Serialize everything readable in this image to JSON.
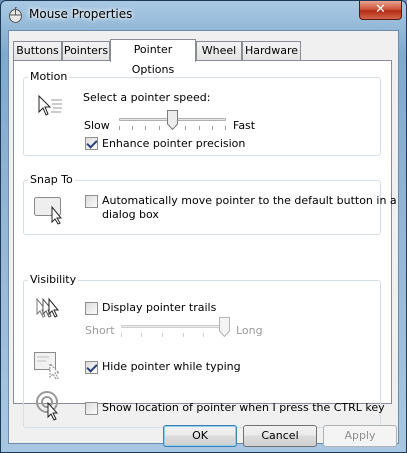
{
  "window": {
    "title": "Mouse Properties",
    "close_glyph": "✕"
  },
  "tabs": [
    {
      "label": "Buttons"
    },
    {
      "label": "Pointers"
    },
    {
      "label": "Pointer Options",
      "active": true
    },
    {
      "label": "Wheel"
    },
    {
      "label": "Hardware"
    }
  ],
  "motion": {
    "title": "Motion",
    "speed_label": "Select a pointer speed:",
    "slow": "Slow",
    "fast": "Fast",
    "speed_level": 0.5,
    "precision_label": "Enhance pointer precision",
    "precision_checked": true
  },
  "snap": {
    "title": "Snap To",
    "line1": "Automatically move pointer to the default button in a",
    "line2": "dialog box",
    "checked": false
  },
  "visibility": {
    "title": "Visibility",
    "trails_label": "Display pointer trails",
    "trails_checked": false,
    "short": "Short",
    "long": "Long",
    "trail_level": 1.0,
    "hide_label": "Hide pointer while typing",
    "hide_checked": true,
    "ctrl_label": "Show location of pointer when I press the CTRL key",
    "ctrl_checked": false
  },
  "buttons": {
    "ok": "OK",
    "cancel": "Cancel",
    "apply": "Apply"
  },
  "colors": {
    "titlebar": "#8fb3d3",
    "close": "#c7452b",
    "panel": "#ffffff",
    "default_border": "#3c7fb1"
  }
}
